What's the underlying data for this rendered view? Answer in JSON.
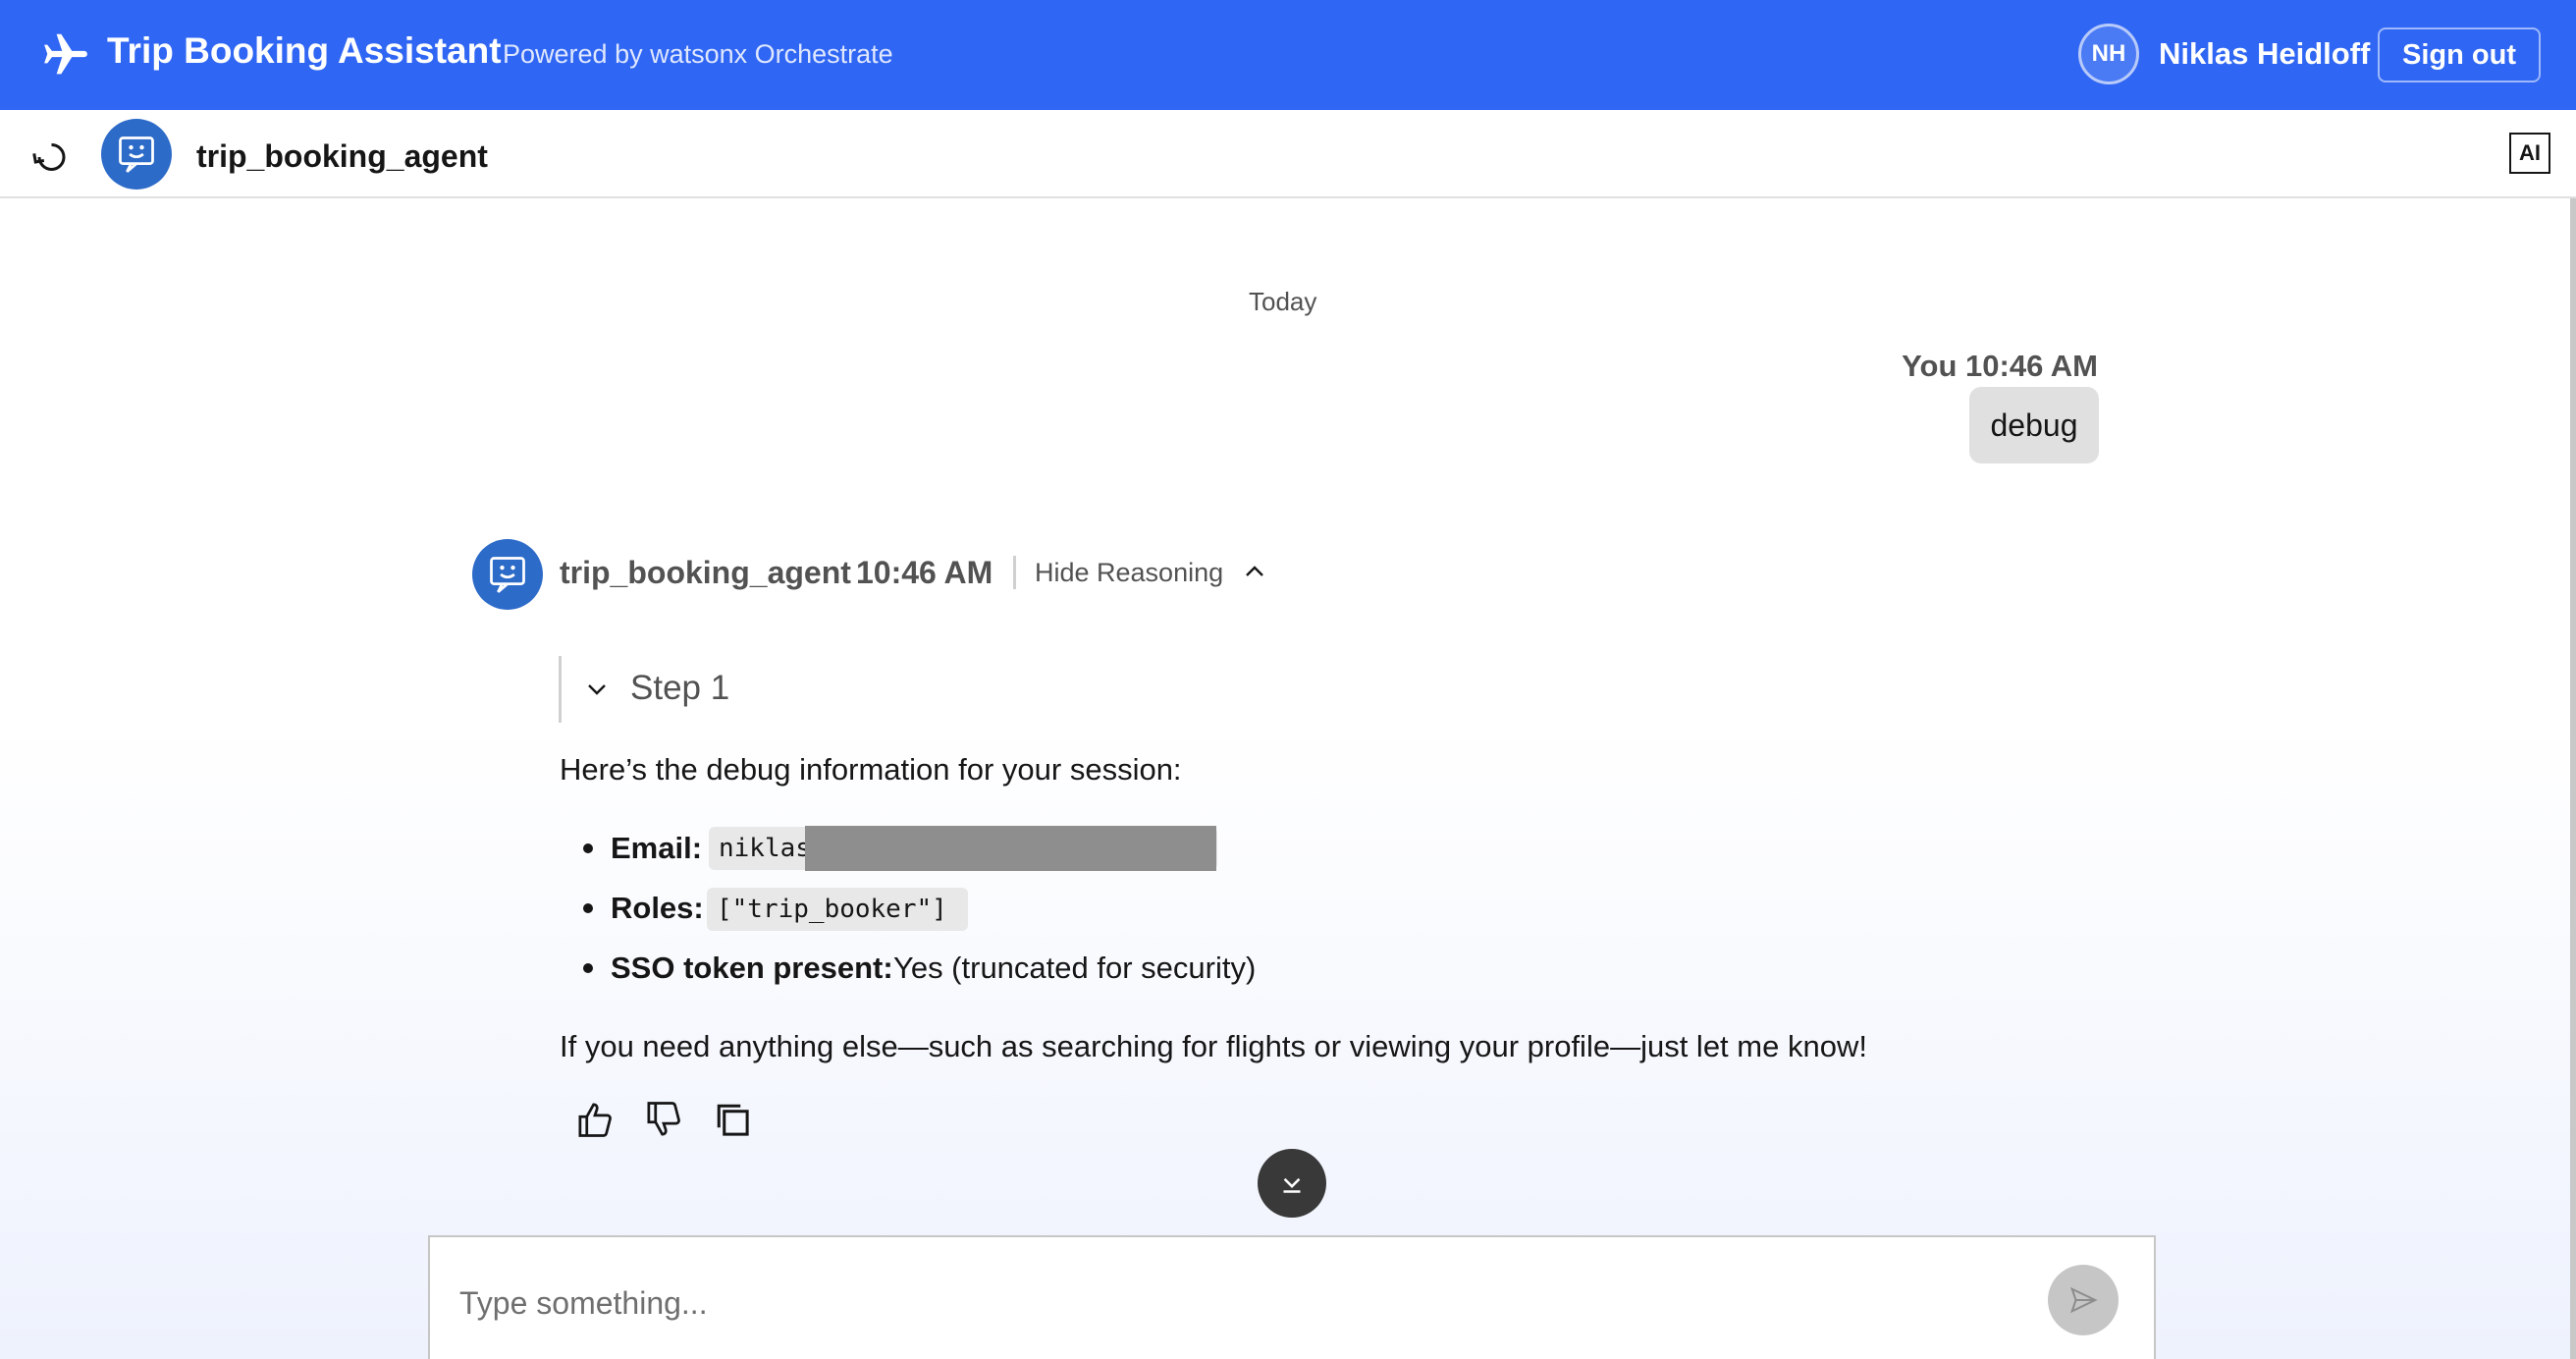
{
  "header": {
    "title": "Trip Booking Assistant",
    "powered_by": "Powered by watsonx Orchestrate",
    "user_initials": "NH",
    "user_name": "Niklas Heidloff",
    "sign_out_label": "Sign out",
    "brand_color": "#2f66f3"
  },
  "agent_bar": {
    "agent_name": "trip_booking_agent",
    "ai_badge": "AI"
  },
  "conversation": {
    "date_divider": "Today",
    "user_message": {
      "author": "You",
      "time": "10:46 AM",
      "text": "debug"
    },
    "agent_message": {
      "author": "trip_booking_agent",
      "time": "10:46 AM",
      "reasoning_toggle": "Hide Reasoning",
      "step_label": "Step 1",
      "intro": "Here’s the debug information for your session:",
      "items": [
        {
          "label": "Email:",
          "code": "niklas"
        },
        {
          "label": "Roles:",
          "code": "[\"trip_booker\"]"
        },
        {
          "label": "SSO token present:",
          "value": "Yes (truncated for security)"
        }
      ],
      "closing": "If you need anything else—such as searching for flights or viewing your profile—just let me know!"
    }
  },
  "composer": {
    "placeholder": "Type something..."
  },
  "icons": {
    "brand": "airplane-icon",
    "restart": "restart-icon",
    "agent": "chat-bot-icon",
    "thumbs_up": "thumbs-up-icon",
    "thumbs_down": "thumbs-down-icon",
    "copy": "copy-icon",
    "scroll_down": "scroll-down-icon",
    "send": "send-icon"
  }
}
